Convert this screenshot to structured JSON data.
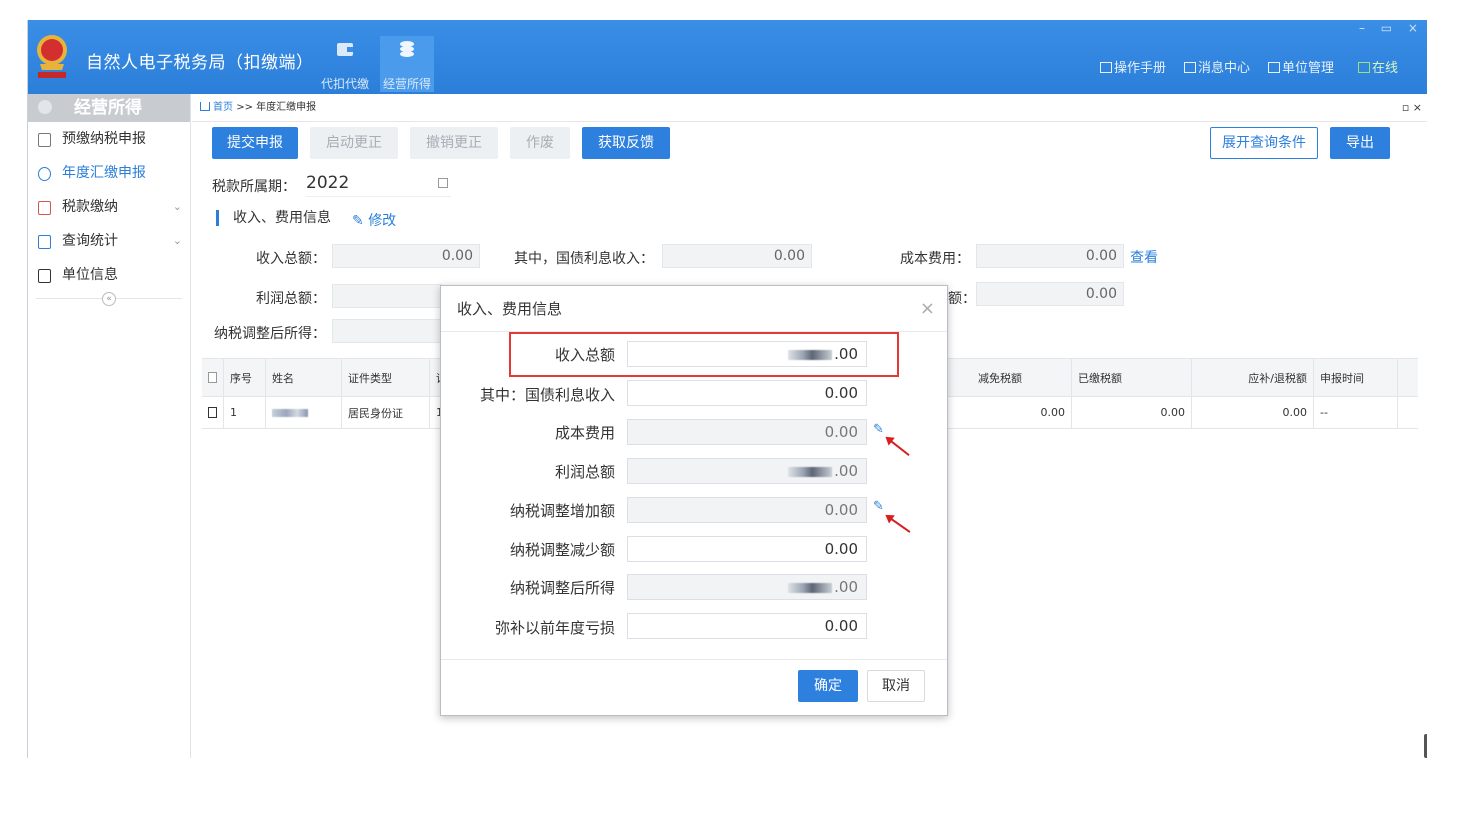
{
  "app": {
    "title": "自然人电子税务局（扣缴端）",
    "modules": [
      {
        "label": "代扣代缴"
      },
      {
        "label": "经营所得"
      }
    ],
    "links": {
      "manual": "操作手册",
      "messages": "消息中心",
      "unit": "单位管理",
      "online": "在线"
    },
    "window_controls": "– ▭ ×"
  },
  "sidebar": {
    "header": "经营所得",
    "items": [
      {
        "label": "预缴纳税申报"
      },
      {
        "label": "年度汇缴申报"
      },
      {
        "label": "税款缴纳",
        "caret": "⌄"
      },
      {
        "label": "查询统计",
        "caret": "⌄"
      },
      {
        "label": "单位信息"
      }
    ],
    "collapse": "«"
  },
  "breadcrumb": {
    "home": "首页",
    "sep": ">>",
    "current": "年度汇缴申报",
    "close": "▫ ×"
  },
  "toolbar": {
    "submit": "提交申报",
    "start_correction": "启动更正",
    "cancel_correction": "撤销更正",
    "void": "作废",
    "get_feedback": "获取反馈",
    "expand_query": "展开查询条件",
    "export": "导出"
  },
  "period": {
    "label": "税款所属期：",
    "value": "2022"
  },
  "section": {
    "title": "收入、费用信息",
    "edit": "修改"
  },
  "fields": {
    "total_income_label": "收入总额：",
    "total_income_value": "0.00",
    "bond_interest_label": "其中，国债利息收入：",
    "bond_interest_value": "0.00",
    "cost_label": "成本费用：",
    "cost_value": "0.00",
    "view_link": "查看",
    "profit_label": "利润总额：",
    "partial_label": "额：",
    "partial_value": "0.00",
    "adjusted_label": "纳税调整后所得："
  },
  "table": {
    "headers": [
      "序号",
      "姓名",
      "证件类型",
      "证",
      "减免税额",
      "已缴税额",
      "应补/退税额",
      "申报时间"
    ],
    "rows": [
      {
        "index": "1",
        "id_type": "居民身份证",
        "id_no": "1",
        "reduction": "0.00",
        "paid": "0.00",
        "due": "0.00",
        "time": "--"
      }
    ]
  },
  "modal": {
    "title": "收入、费用信息",
    "close": "×",
    "rows": [
      {
        "label": "收入总额",
        "value": ".00"
      },
      {
        "label": "其中：国债利息收入",
        "value": "0.00"
      },
      {
        "label": "成本费用",
        "value": "0.00"
      },
      {
        "label": "利润总额",
        "value": ".00"
      },
      {
        "label": "纳税调整增加额",
        "value": "0.00"
      },
      {
        "label": "纳税调整减少额",
        "value": "0.00"
      },
      {
        "label": "纳税调整后所得",
        "value": ".00"
      },
      {
        "label": "弥补以前年度亏损",
        "value": "0.00"
      }
    ],
    "edit_icon": "✎",
    "ok": "确定",
    "cancel": "取消"
  },
  "colors": {
    "primary": "#2d80de",
    "titlebar": "#3a8ee6",
    "highlight": "#e53935"
  }
}
